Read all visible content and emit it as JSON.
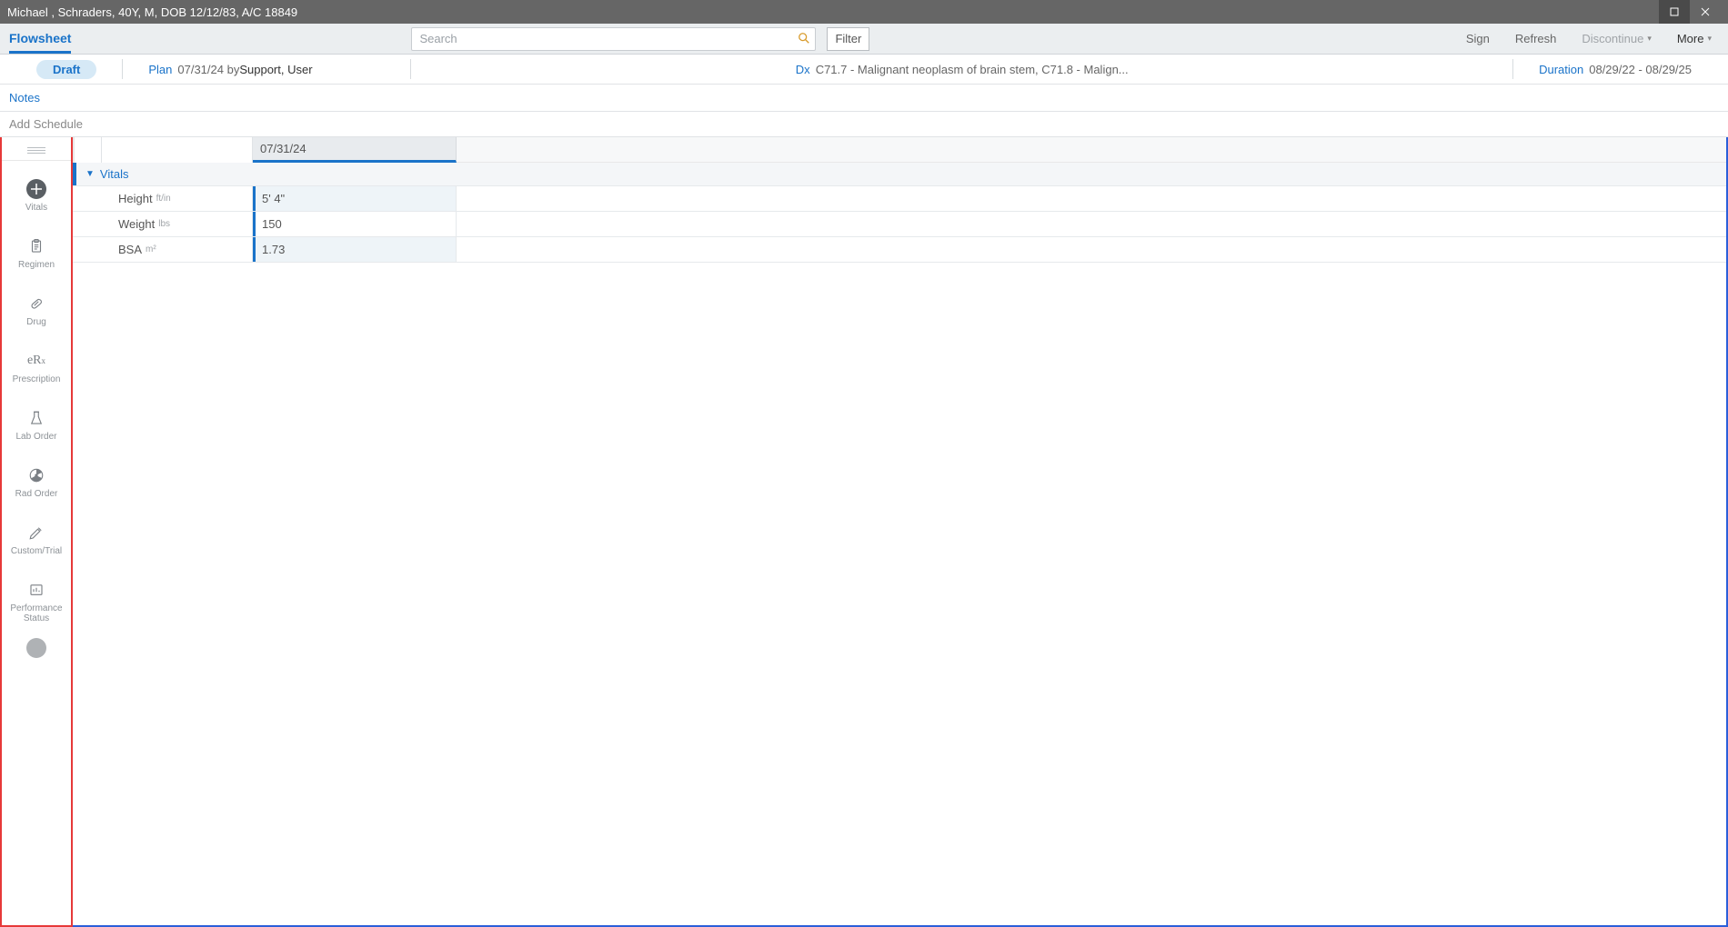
{
  "titlebar": "Michael , Schraders, 40Y, M, DOB 12/12/83, A/C 18849",
  "toolbar": {
    "brand": "Flowsheet",
    "search_placeholder": "Search",
    "filter": "Filter",
    "sign": "Sign",
    "refresh": "Refresh",
    "discontinue": "Discontinue",
    "more": "More"
  },
  "info": {
    "draft": "Draft",
    "plan_label": "Plan",
    "plan_date": "07/31/24 by ",
    "plan_by": "Support, User",
    "dx_label": "Dx",
    "dx_value": "C71.7 - Malignant neoplasm of brain stem, C71.8 - Malign...",
    "duration_label": "Duration",
    "duration_value": "08/29/22 - 08/29/25"
  },
  "notes": "Notes",
  "add_schedule": "Add Schedule",
  "sidebar": [
    {
      "label": "Vitals"
    },
    {
      "label": "Regimen"
    },
    {
      "label": "Drug"
    },
    {
      "label": "Prescription"
    },
    {
      "label": "Lab Order"
    },
    {
      "label": "Rad Order"
    },
    {
      "label": "Custom/Trial"
    },
    {
      "label": "Performance Status"
    }
  ],
  "date_column": "07/31/24",
  "vitals_section": "Vitals",
  "rows": [
    {
      "name": "Height",
      "unit": "ft/in",
      "value": "5' 4\""
    },
    {
      "name": "Weight",
      "unit": "lbs",
      "value": "150"
    },
    {
      "name": "BSA",
      "unit": "m²",
      "value": "1.73"
    }
  ]
}
